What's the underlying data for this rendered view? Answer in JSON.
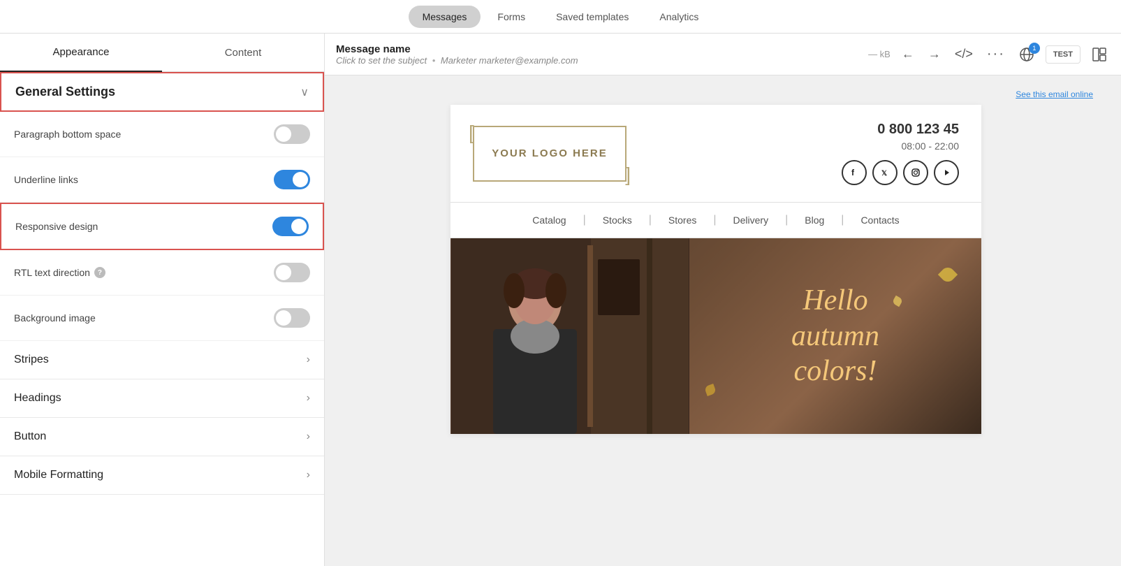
{
  "topNav": {
    "tabs": [
      {
        "id": "messages",
        "label": "Messages",
        "active": true
      },
      {
        "id": "forms",
        "label": "Forms",
        "active": false
      },
      {
        "id": "saved-templates",
        "label": "Saved templates",
        "active": false
      },
      {
        "id": "analytics",
        "label": "Analytics",
        "active": false
      }
    ]
  },
  "sidebar": {
    "tabs": [
      {
        "id": "appearance",
        "label": "Appearance",
        "active": true
      },
      {
        "id": "content",
        "label": "Content",
        "active": false
      }
    ],
    "generalSettings": {
      "title": "General Settings",
      "chevron": "›"
    },
    "settings": [
      {
        "id": "paragraph-bottom-space",
        "label": "Paragraph bottom space",
        "toggled": false,
        "hasHelp": false
      },
      {
        "id": "underline-links",
        "label": "Underline links",
        "toggled": true,
        "hasHelp": false
      },
      {
        "id": "responsive-design",
        "label": "Responsive design",
        "toggled": true,
        "hasHelp": false,
        "highlighted": true
      },
      {
        "id": "rtl-text-direction",
        "label": "RTL text direction",
        "toggled": false,
        "hasHelp": true
      },
      {
        "id": "background-image",
        "label": "Background image",
        "toggled": false,
        "hasHelp": false
      }
    ],
    "sections": [
      {
        "id": "stripes",
        "label": "Stripes"
      },
      {
        "id": "headings",
        "label": "Headings"
      },
      {
        "id": "button",
        "label": "Button"
      },
      {
        "id": "mobile-formatting",
        "label": "Mobile Formatting"
      }
    ]
  },
  "toolbar": {
    "messageName": "Message name",
    "subject": "Click to set the subject",
    "separator": "•",
    "sender": "Marketer marketer@example.com",
    "kbLabel": "— kB",
    "notificationCount": "1",
    "testButtonLabel": "TEST",
    "seeOnlineLabel": "See this email online"
  },
  "email": {
    "logo": "YOUR LOGO HERE",
    "phone": "0 800 123 45",
    "hours": "08:00 - 22:00",
    "socialIcons": [
      "f",
      "t",
      "in",
      "▶"
    ],
    "nav": [
      {
        "label": "Catalog"
      },
      {
        "label": "Stocks"
      },
      {
        "label": "Stores"
      },
      {
        "label": "Delivery"
      },
      {
        "label": "Blog"
      },
      {
        "label": "Contacts"
      }
    ],
    "hero": {
      "text1": "Hello",
      "text2": "autumn",
      "text3": "colors!"
    }
  }
}
